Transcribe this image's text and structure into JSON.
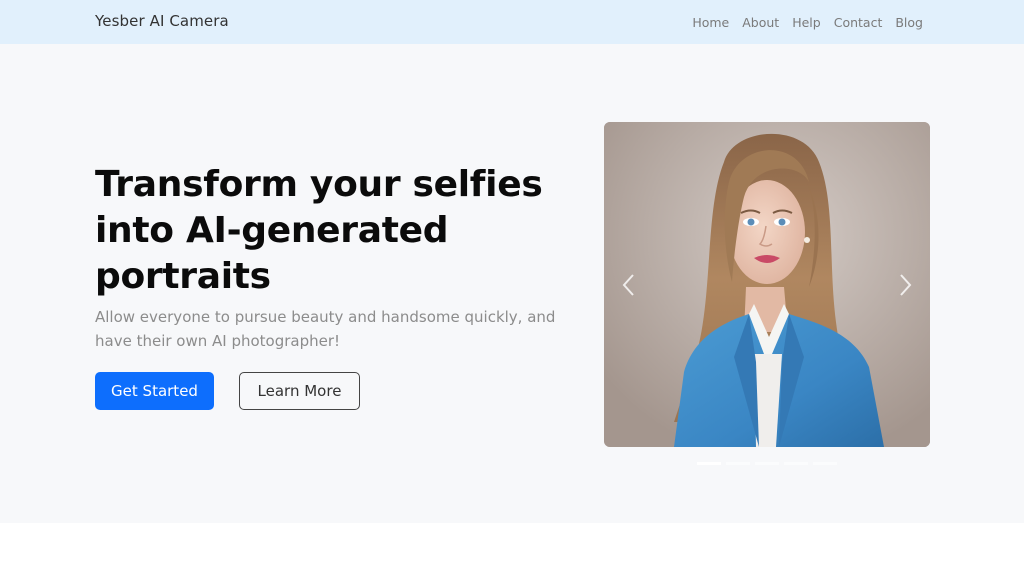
{
  "navbar": {
    "brand": "Yesber AI Camera",
    "links": [
      {
        "label": "Home"
      },
      {
        "label": "About"
      },
      {
        "label": "Help"
      },
      {
        "label": "Contact"
      },
      {
        "label": "Blog"
      }
    ]
  },
  "hero": {
    "title": "Transform your selfies into AI-generated portraits",
    "subtitle": "Allow everyone to pursue beauty and handsome quickly, and have their own AI photographer!",
    "primary_button": "Get Started",
    "secondary_button": "Learn More"
  },
  "carousel": {
    "image_alt": "AI-generated portrait of a woman in a blue blazer",
    "prev_icon": "chevron-left-icon",
    "next_icon": "chevron-right-icon",
    "slide_count": 5,
    "active_index": 0
  },
  "colors": {
    "navbar_bg": "#e1f0fc",
    "hero_bg": "#f7f8fa",
    "primary": "#0d6efd",
    "title": "#0b0b0b",
    "subtitle": "#8c8c8c"
  }
}
